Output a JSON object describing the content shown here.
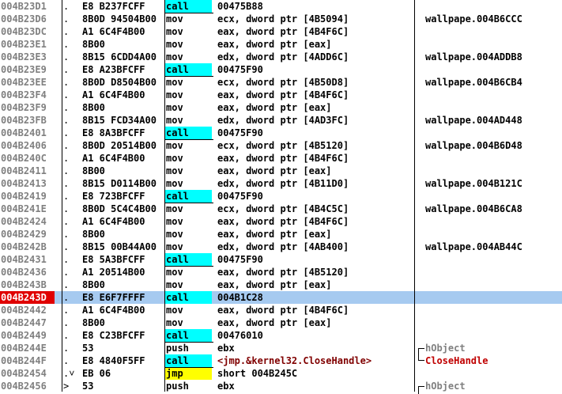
{
  "rows": [
    {
      "addr": "004B23D1",
      "mark": ".",
      "hex": "E8 B237FCFF",
      "mn": "call",
      "op": "00475B88",
      "cm": ""
    },
    {
      "addr": "004B23D6",
      "mark": ".",
      "hex": "8B0D 94504B00",
      "mn": "mov",
      "op": "ecx, dword ptr [4B5094]",
      "cm": "wallpape.004B6CCC"
    },
    {
      "addr": "004B23DC",
      "mark": ".",
      "hex": "A1 6C4F4B00",
      "mn": "mov",
      "op": "eax, dword ptr [4B4F6C]",
      "cm": ""
    },
    {
      "addr": "004B23E1",
      "mark": ".",
      "hex": "8B00",
      "mn": "mov",
      "op": "eax, dword ptr [eax]",
      "cm": ""
    },
    {
      "addr": "004B23E3",
      "mark": ".",
      "hex": "8B15 6CDD4A00",
      "mn": "mov",
      "op": "edx, dword ptr [4ADD6C]",
      "cm": "wallpape.004ADDB8"
    },
    {
      "addr": "004B23E9",
      "mark": ".",
      "hex": "E8 A23BFCFF",
      "mn": "call",
      "op": "00475F90",
      "cm": ""
    },
    {
      "addr": "004B23EE",
      "mark": ".",
      "hex": "8B0D D8504B00",
      "mn": "mov",
      "op": "ecx, dword ptr [4B50D8]",
      "cm": "wallpape.004B6CB4"
    },
    {
      "addr": "004B23F4",
      "mark": ".",
      "hex": "A1 6C4F4B00",
      "mn": "mov",
      "op": "eax, dword ptr [4B4F6C]",
      "cm": ""
    },
    {
      "addr": "004B23F9",
      "mark": ".",
      "hex": "8B00",
      "mn": "mov",
      "op": "eax, dword ptr [eax]",
      "cm": ""
    },
    {
      "addr": "004B23FB",
      "mark": ".",
      "hex": "8B15 FCD34A00",
      "mn": "mov",
      "op": "edx, dword ptr [4AD3FC]",
      "cm": "wallpape.004AD448"
    },
    {
      "addr": "004B2401",
      "mark": ".",
      "hex": "E8 8A3BFCFF",
      "mn": "call",
      "op": "00475F90",
      "cm": ""
    },
    {
      "addr": "004B2406",
      "mark": ".",
      "hex": "8B0D 20514B00",
      "mn": "mov",
      "op": "ecx, dword ptr [4B5120]",
      "cm": "wallpape.004B6D48"
    },
    {
      "addr": "004B240C",
      "mark": ".",
      "hex": "A1 6C4F4B00",
      "mn": "mov",
      "op": "eax, dword ptr [4B4F6C]",
      "cm": ""
    },
    {
      "addr": "004B2411",
      "mark": ".",
      "hex": "8B00",
      "mn": "mov",
      "op": "eax, dword ptr [eax]",
      "cm": ""
    },
    {
      "addr": "004B2413",
      "mark": ".",
      "hex": "8B15 D0114B00",
      "mn": "mov",
      "op": "edx, dword ptr [4B11D0]",
      "cm": "wallpape.004B121C"
    },
    {
      "addr": "004B2419",
      "mark": ".",
      "hex": "E8 723BFCFF",
      "mn": "call",
      "op": "00475F90",
      "cm": ""
    },
    {
      "addr": "004B241E",
      "mark": ".",
      "hex": "8B0D 5C4C4B00",
      "mn": "mov",
      "op": "ecx, dword ptr [4B4C5C]",
      "cm": "wallpape.004B6CA8"
    },
    {
      "addr": "004B2424",
      "mark": ".",
      "hex": "A1 6C4F4B00",
      "mn": "mov",
      "op": "eax, dword ptr [4B4F6C]",
      "cm": ""
    },
    {
      "addr": "004B2429",
      "mark": ".",
      "hex": "8B00",
      "mn": "mov",
      "op": "eax, dword ptr [eax]",
      "cm": ""
    },
    {
      "addr": "004B242B",
      "mark": ".",
      "hex": "8B15 00B44A00",
      "mn": "mov",
      "op": "edx, dword ptr [4AB400]",
      "cm": "wallpape.004AB44C"
    },
    {
      "addr": "004B2431",
      "mark": ".",
      "hex": "E8 5A3BFCFF",
      "mn": "call",
      "op": "00475F90",
      "cm": ""
    },
    {
      "addr": "004B2436",
      "mark": ".",
      "hex": "A1 20514B00",
      "mn": "mov",
      "op": "eax, dword ptr [4B5120]",
      "cm": ""
    },
    {
      "addr": "004B243B",
      "mark": ".",
      "hex": "8B00",
      "mn": "mov",
      "op": "eax, dword ptr [eax]",
      "cm": ""
    },
    {
      "addr": "004B243D",
      "mark": ".",
      "hex": "E8 E6F7FFFF",
      "mn": "call",
      "op": "004B1C28",
      "cm": "",
      "bp": true,
      "sel": true
    },
    {
      "addr": "004B2442",
      "mark": ".",
      "hex": "A1 6C4F4B00",
      "mn": "mov",
      "op": "eax, dword ptr [4B4F6C]",
      "cm": ""
    },
    {
      "addr": "004B2447",
      "mark": ".",
      "hex": "8B00",
      "mn": "mov",
      "op": "eax, dword ptr [eax]",
      "cm": ""
    },
    {
      "addr": "004B2449",
      "mark": ".",
      "hex": "E8 C23BFCFF",
      "mn": "call",
      "op": "00476010",
      "cm": ""
    },
    {
      "addr": "004B244E",
      "mark": ".",
      "hex": "53",
      "mn": "push",
      "op": "ebx",
      "cm": "hObject",
      "cmStyle": "grey"
    },
    {
      "addr": "004B244F",
      "mark": ".",
      "hex": "E8 4840F5FF",
      "mn": "call",
      "op": "<jmp.&kernel32.CloseHandle>",
      "cm": "CloseHandle",
      "opStyle": "red",
      "cmStyle": "red"
    },
    {
      "addr": "004B2454",
      "mark": ".˅",
      "hex": "EB 06",
      "mn": "jmp",
      "op": "short 004B245C",
      "cm": ""
    },
    {
      "addr": "004B2456",
      "mark": ">",
      "hex": "53",
      "mn": "push",
      "op": "ebx",
      "cm": "hObject",
      "cmStyle": "grey"
    }
  ]
}
